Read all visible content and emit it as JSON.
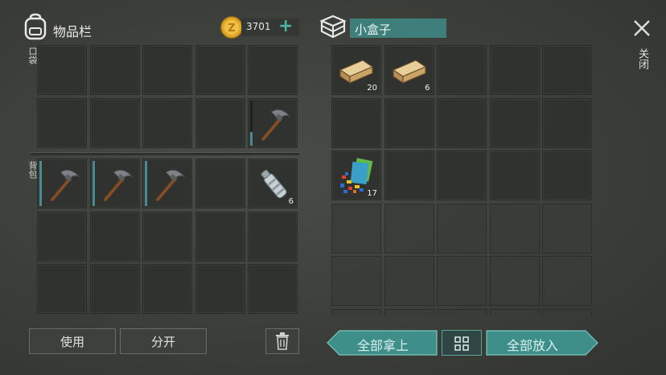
{
  "inventory": {
    "title": "物品栏",
    "coins": "3701",
    "pocket_label": "口袋",
    "backpack_label": "背包",
    "pocket_slots": [
      {
        "item": "",
        "count": ""
      },
      {
        "item": "",
        "count": ""
      },
      {
        "item": "",
        "count": ""
      },
      {
        "item": "",
        "count": ""
      },
      {
        "item": "",
        "count": ""
      },
      {
        "item": "",
        "count": ""
      },
      {
        "item": "",
        "count": ""
      },
      {
        "item": "",
        "count": ""
      },
      {
        "item": "",
        "count": ""
      },
      {
        "item": "pickaxe",
        "count": "",
        "durability": 0.3
      }
    ],
    "backpack_slots": [
      {
        "item": "pickaxe",
        "count": "",
        "durability": 1.0
      },
      {
        "item": "pickaxe",
        "count": "",
        "durability": 1.0
      },
      {
        "item": "pickaxe",
        "count": "",
        "durability": 1.0
      },
      {
        "item": "",
        "count": ""
      },
      {
        "item": "bottle",
        "count": "6"
      },
      {
        "item": "",
        "count": ""
      },
      {
        "item": "",
        "count": ""
      },
      {
        "item": "",
        "count": ""
      },
      {
        "item": "",
        "count": ""
      },
      {
        "item": "",
        "count": ""
      },
      {
        "item": "",
        "count": ""
      },
      {
        "item": "",
        "count": ""
      },
      {
        "item": "",
        "count": ""
      },
      {
        "item": "",
        "count": ""
      },
      {
        "item": "",
        "count": ""
      }
    ],
    "use_label": "使用",
    "split_label": "分开"
  },
  "container": {
    "name": "小盒子",
    "slots": [
      {
        "item": "wood-plank",
        "count": "20"
      },
      {
        "item": "wood-plank",
        "count": "6"
      },
      {
        "item": "",
        "count": ""
      },
      {
        "item": "",
        "count": ""
      },
      {
        "item": "",
        "count": ""
      },
      {
        "item": "",
        "count": ""
      },
      {
        "item": "",
        "count": ""
      },
      {
        "item": "",
        "count": ""
      },
      {
        "item": "",
        "count": ""
      },
      {
        "item": "",
        "count": ""
      },
      {
        "item": "scrap-parts",
        "count": "17"
      },
      {
        "item": "",
        "count": ""
      },
      {
        "item": "",
        "count": ""
      },
      {
        "item": "",
        "count": ""
      },
      {
        "item": "",
        "count": ""
      }
    ],
    "take_all_label": "全部拿上",
    "put_all_label": "全部放入"
  },
  "close_label": "关闭",
  "colors": {
    "accent_teal": "#3e8f8a",
    "coin_gold": "#e0a92a",
    "slot_bg": "#30322f"
  }
}
